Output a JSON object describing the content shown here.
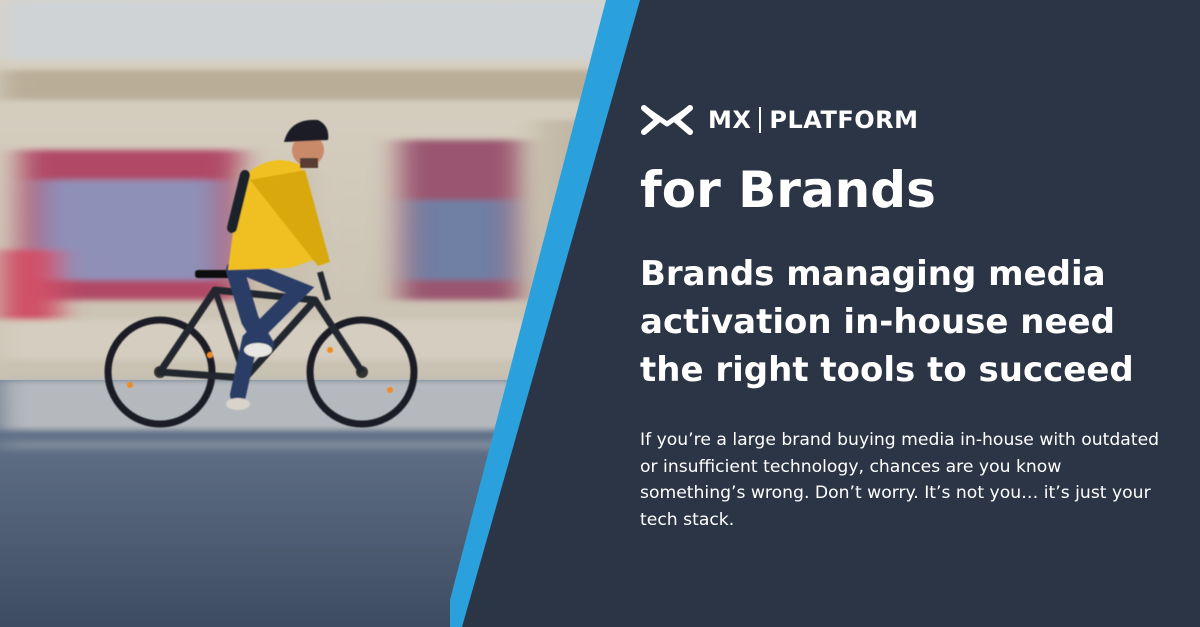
{
  "brand": {
    "logo_icon": "mx-logo-icon",
    "name_left": "MX",
    "name_right": "PLATFORM"
  },
  "title": "for Brands",
  "headline": "Brands managing media activation in-house need the right tools to succeed",
  "body": "If you’re a large brand buying media in-house with outdated or insufficient technology, chances are you know something’s wrong. Don’t worry. It’s not you… it’s just your tech stack.",
  "colors": {
    "panel_background": "#2c3545",
    "accent_stripe": "#2aa0dc",
    "text": "#ffffff",
    "jacket": "#f0c020"
  }
}
